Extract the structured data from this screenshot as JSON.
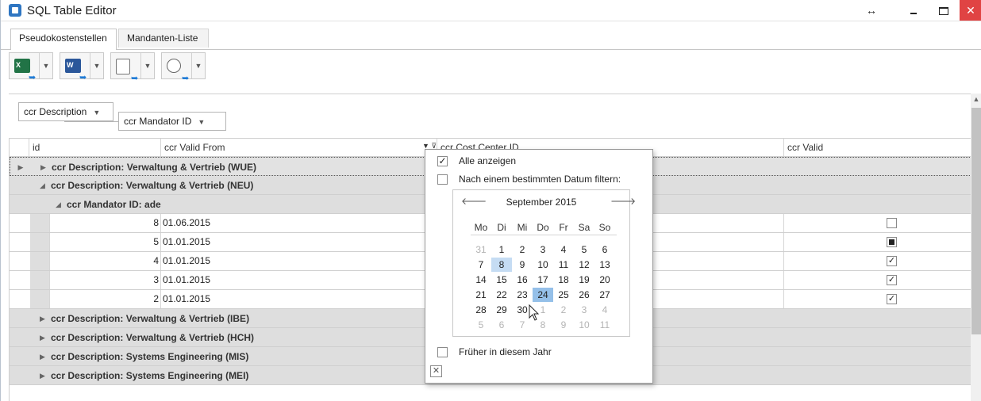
{
  "window": {
    "title": "SQL Table Editor",
    "resize_glyph": "↔",
    "close_glyph": "✕"
  },
  "tabs": [
    {
      "label": "Pseudokostenstellen",
      "active": true
    },
    {
      "label": "Mandanten-Liste",
      "active": false
    }
  ],
  "toolbar": {
    "buttons": [
      {
        "name": "excel-export",
        "icon": "excel-icon",
        "tag": "X"
      },
      {
        "name": "word-export",
        "icon": "word-icon",
        "tag": "W"
      },
      {
        "name": "file-export",
        "icon": "export-file-icon",
        "tag": ""
      },
      {
        "name": "web-export",
        "icon": "globe-icon",
        "tag": ""
      }
    ],
    "arrow_glyph": "▼"
  },
  "group_panel": {
    "chips": [
      {
        "label": "ccr Description"
      },
      {
        "label": "ccr Mandator ID"
      }
    ]
  },
  "grid": {
    "columns": [
      {
        "label": "id"
      },
      {
        "label": "ccr Valid From"
      },
      {
        "label": "ccr Cost Center ID"
      },
      {
        "label": "ccr Valid"
      }
    ],
    "group_rows_top": [
      {
        "label": "ccr Description: Verwaltung & Vertrieb (WUE)",
        "expanded": false
      },
      {
        "label": "ccr Description: Verwaltung & Vertrieb (NEU)",
        "expanded": true
      }
    ],
    "subgroup": {
      "label": "ccr Mandator ID: ade"
    },
    "rows": [
      {
        "id": "8",
        "valid_from": "01.06.2015",
        "valid": "unchecked"
      },
      {
        "id": "5",
        "valid_from": "01.01.2015",
        "valid": "indeterminate"
      },
      {
        "id": "4",
        "valid_from": "01.01.2015",
        "valid": "checked"
      },
      {
        "id": "3",
        "valid_from": "01.01.2015",
        "valid": "checked"
      },
      {
        "id": "2",
        "valid_from": "01.01.2015",
        "valid": "checked"
      }
    ],
    "group_rows_bottom": [
      {
        "label": "ccr Description: Verwaltung & Vertrieb (IBE)"
      },
      {
        "label": "ccr Description: Verwaltung & Vertrieb (HCH)"
      },
      {
        "label": "ccr Description: Systems Engineering (MIS)"
      },
      {
        "label": "ccr Description: Systems Engineering (MEI)"
      }
    ]
  },
  "filter_popup": {
    "show_all_label": "Alle anzeigen",
    "show_all_checked": true,
    "specific_date_label": "Nach einem bestimmten Datum filtern:",
    "specific_date_checked": false,
    "earlier_this_year_label": "Früher in diesem Jahr",
    "earlier_this_year_checked": false,
    "close_glyph": "✕",
    "calendar": {
      "month_title": "September 2015",
      "prev_glyph": "🡐",
      "next_glyph": "🡒",
      "weekdays": [
        "Mo",
        "Di",
        "Mi",
        "Do",
        "Fr",
        "Sa",
        "So"
      ],
      "weeks": [
        [
          "31",
          "1",
          "2",
          "3",
          "4",
          "5",
          "6"
        ],
        [
          "7",
          "8",
          "9",
          "10",
          "11",
          "12",
          "13"
        ],
        [
          "14",
          "15",
          "16",
          "17",
          "18",
          "19",
          "20"
        ],
        [
          "21",
          "22",
          "23",
          "24",
          "25",
          "26",
          "27"
        ],
        [
          "28",
          "29",
          "30",
          "1",
          "2",
          "3",
          "4"
        ],
        [
          "5",
          "6",
          "7",
          "8",
          "9",
          "10",
          "11"
        ]
      ],
      "hovered_day": "8",
      "today": "24"
    }
  },
  "colors": {
    "group_row": "#dedede",
    "selected_day": "#c5dcf3",
    "today": "#95c0e9",
    "close_button": "#e04343"
  }
}
